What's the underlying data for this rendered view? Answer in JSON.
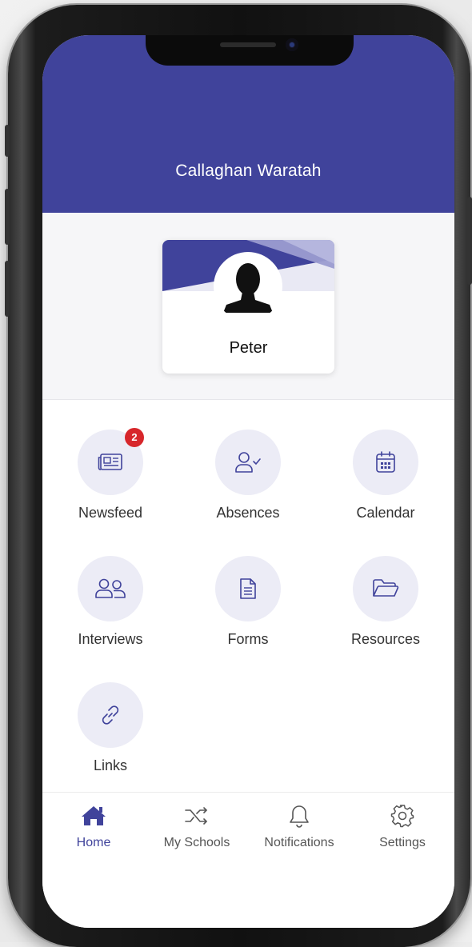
{
  "header": {
    "school_name": "Callaghan Waratah"
  },
  "profile": {
    "name": "Peter"
  },
  "tiles": [
    {
      "label": "Newsfeed",
      "icon": "newspaper-icon",
      "badge": "2"
    },
    {
      "label": "Absences",
      "icon": "user-check-icon"
    },
    {
      "label": "Calendar",
      "icon": "calendar-icon"
    },
    {
      "label": "Interviews",
      "icon": "people-icon"
    },
    {
      "label": "Forms",
      "icon": "document-icon"
    },
    {
      "label": "Resources",
      "icon": "folder-icon"
    },
    {
      "label": "Links",
      "icon": "link-icon"
    }
  ],
  "nav": {
    "items": [
      {
        "label": "Home",
        "icon": "home-icon",
        "active": true
      },
      {
        "label": "My Schools",
        "icon": "shuffle-icon"
      },
      {
        "label": "Notifications",
        "icon": "bell-icon"
      },
      {
        "label": "Settings",
        "icon": "gear-icon"
      }
    ]
  },
  "colors": {
    "brand": "#40439b",
    "tile_bg": "#ececf6",
    "badge": "#d7262b"
  }
}
